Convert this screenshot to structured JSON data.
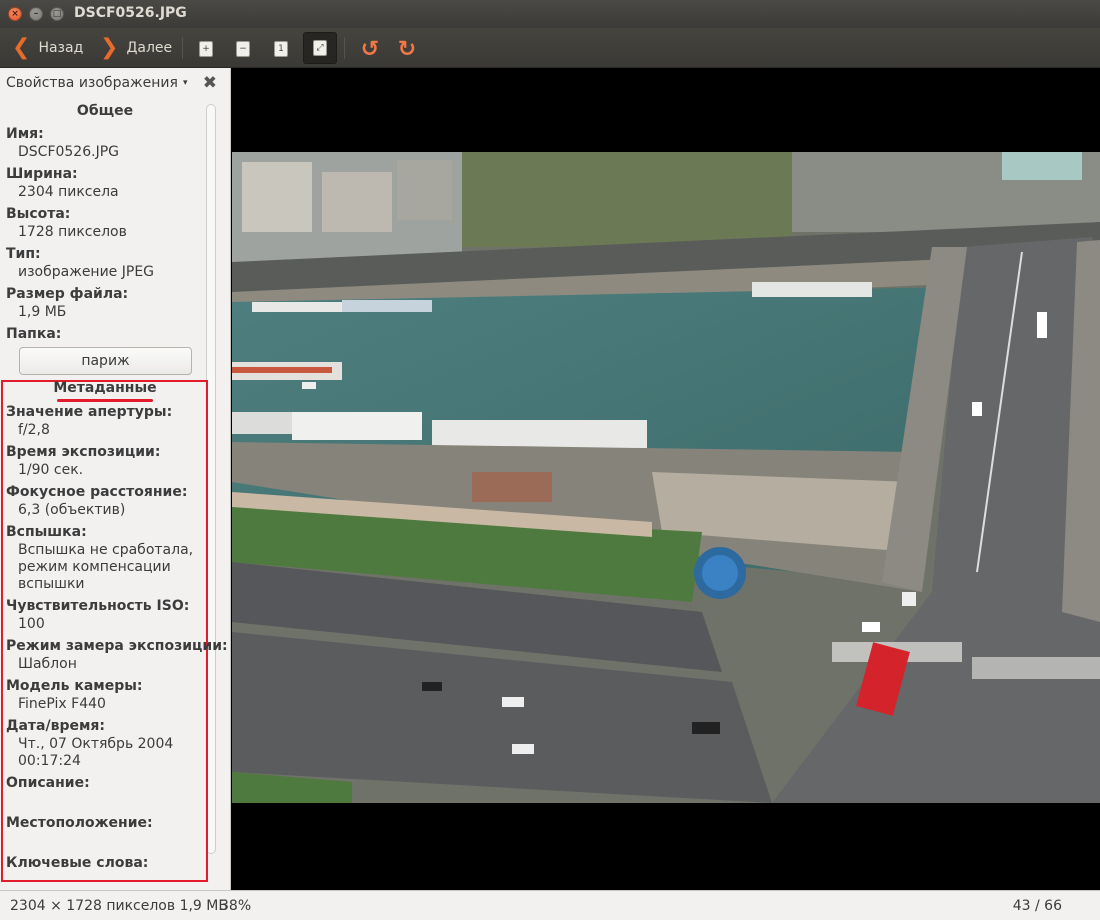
{
  "window": {
    "title": "DSCF0526.JPG",
    "close_glyph": "×",
    "min_glyph": "–",
    "max_glyph": "□"
  },
  "toolbar": {
    "back_label": "Назад",
    "forward_label": "Далее",
    "zoom_in_glyph": "+",
    "zoom_out_glyph": "−",
    "zoom_normal_glyph": "1",
    "fit_glyph": "⤢",
    "rotate_left_glyph": "↺",
    "rotate_right_glyph": "↻",
    "accent_color": "#e66b2c"
  },
  "sidebar": {
    "header": "Свойства изображения",
    "dropdown_glyph": "▾",
    "close_glyph": "✖",
    "general": {
      "title": "Общее",
      "name_label": "Имя:",
      "name_value": "DSCF0526.JPG",
      "width_label": "Ширина:",
      "width_value": "2304 пиксела",
      "height_label": "Высота:",
      "height_value": "1728 пикселов",
      "type_label": "Тип:",
      "type_value": "изображение JPEG",
      "size_label": "Размер файла:",
      "size_value": "1,9 МБ",
      "folder_label": "Папка:",
      "folder_value": "париж"
    },
    "metadata": {
      "title": "Метаданные",
      "aperture_label": "Значение апертуры:",
      "aperture_value": "f/2,8",
      "exposure_label": "Время экспозиции:",
      "exposure_value": "1/90 сек.",
      "focal_label": "Фокусное расстояние:",
      "focal_value": "6,3 (объектив)",
      "flash_label": "Вспышка:",
      "flash_value_1": "Вспышка не сработала,",
      "flash_value_2": "режим компенсации",
      "flash_value_3": "вспышки",
      "iso_label": "Чувствительность ISO:",
      "iso_value": "100",
      "metering_label": "Режим замера экспозиции:",
      "metering_value": "Шаблон",
      "camera_label": "Модель камеры:",
      "camera_value": "FinePix F440",
      "datetime_label": "Дата/время:",
      "datetime_value_1": "Чт., 07 Октябрь 2004",
      "datetime_value_2": "00:17:24",
      "description_label": "Описание:",
      "location_label": "Местоположение:",
      "keywords_label": "Ключевые слова:",
      "highlight_color": "#e31c2b"
    }
  },
  "statusbar": {
    "dimensions": "2304 × 1728 пикселов  1,9 МБ",
    "zoom": "38%",
    "position": "43 / 66"
  }
}
